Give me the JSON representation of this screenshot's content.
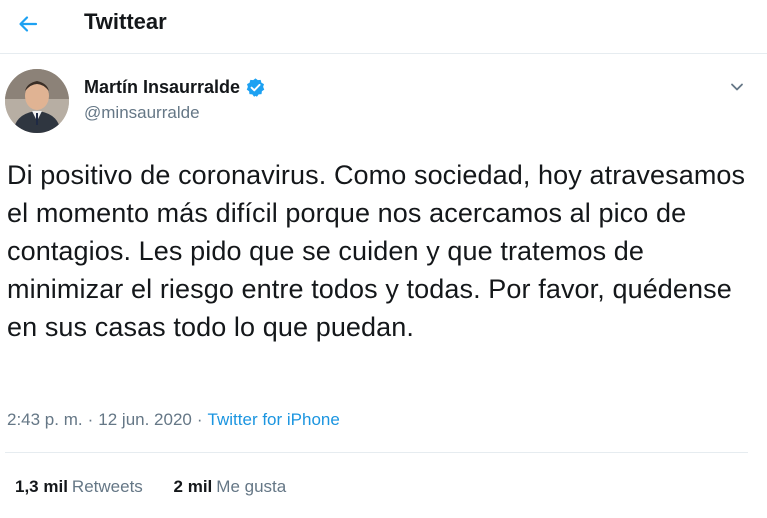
{
  "header": {
    "title": "Twittear",
    "back_icon": "arrow-left-icon"
  },
  "tweet": {
    "author_name": "Martín Insaurralde",
    "verified_icon": "verified-badge-icon",
    "handle": "@minsaurralde",
    "menu_icon": "chevron-down-icon",
    "text": "Di positivo de coronavirus. Como sociedad, hoy atravesamos el momento más difícil porque nos acercamos al pico de contagios. Les pido que se cuiden y que tratemos de minimizar el riesgo entre todos y todas. Por favor, quédense en sus casas todo lo que puedan.",
    "time": "2:43 p. m.",
    "date": "12 jun. 2020",
    "separator": "·",
    "source": "Twitter for iPhone"
  },
  "stats": {
    "retweets_count": "1,3 mil",
    "retweets_label": "Retweets",
    "likes_count": "2 mil",
    "likes_label": "Me gusta"
  },
  "colors": {
    "accent": "#1da1f2",
    "secondary_text": "#657786",
    "divider": "#e6ecf0"
  }
}
